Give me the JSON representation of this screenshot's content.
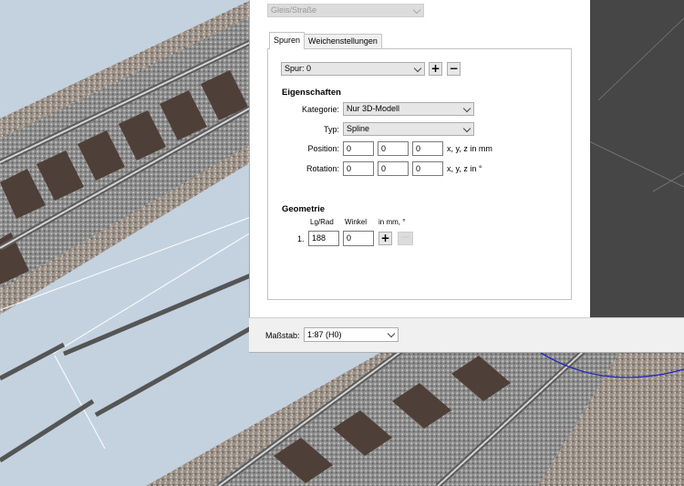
{
  "top_combo": {
    "value": "Gleis/Straße"
  },
  "tabs": [
    {
      "label": "Spuren",
      "active": true
    },
    {
      "label": "Weichenstellungen",
      "active": false
    }
  ],
  "spur": {
    "value": "Spur: 0",
    "add_symbol": "+",
    "remove_symbol": "−"
  },
  "eigenschaften": {
    "heading": "Eigenschaften",
    "kategorie_label": "Kategorie:",
    "kategorie_value": "Nur 3D-Modell",
    "typ_label": "Typ:",
    "typ_value": "Spline",
    "position_label": "Position:",
    "position": [
      "0",
      "0",
      "0"
    ],
    "position_unit": "x, y, z in mm",
    "rotation_label": "Rotation:",
    "rotation": [
      "0",
      "0",
      "0"
    ],
    "rotation_unit": "x, y, z in °"
  },
  "geometrie": {
    "heading": "Geometrie",
    "col_lgrad": "Lg/Rad",
    "col_winkel": "Winkel",
    "col_unit": "in mm, °",
    "row_index": "1.",
    "lgrad_value": "188",
    "winkel_value": "0",
    "add_symbol": "+",
    "more_symbol": "···"
  },
  "footer": {
    "massstab_label": "Maßstab:",
    "massstab_value": "1:87 (H0)"
  }
}
